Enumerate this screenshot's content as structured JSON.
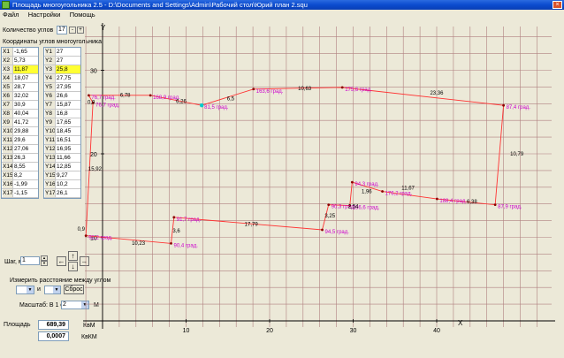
{
  "window": {
    "title": "Площадь многоугольника 2.5 - D:\\Documents and Settings\\Admin\\Рабочий стол\\Юрий план 2.squ",
    "close_glyph": "×"
  },
  "menu": [
    "Файл",
    "Настройки",
    "Помощь"
  ],
  "corners": {
    "label": "Количество углов",
    "value": "17",
    "minus": "-",
    "plus": "+"
  },
  "coords_heading": "Координаты углов многоугольника",
  "coords": {
    "x_labels": [
      "X1",
      "X2",
      "X3",
      "X4",
      "X5",
      "X6",
      "X7",
      "X8",
      "X9",
      "X10",
      "X11",
      "X12",
      "X13",
      "X14",
      "X15",
      "X16",
      "X17"
    ],
    "x_values": [
      "-1,65",
      "5,73",
      "11,87",
      "18,07",
      "28,7",
      "32,02",
      "30,9",
      "40,04",
      "41,72",
      "29,88",
      "29,6",
      "27,06",
      "26,3",
      "8,55",
      "8,2",
      "-1,99",
      "-1,15"
    ],
    "y_labels": [
      "Y1",
      "Y2",
      "Y3",
      "Y4",
      "Y5",
      "Y6",
      "Y7",
      "Y8",
      "Y9",
      "Y10",
      "Y11",
      "Y12",
      "Y13",
      "Y14",
      "Y15",
      "Y16",
      "Y17"
    ],
    "y_values": [
      "27",
      "27",
      "25,8",
      "27,75",
      "27,95",
      "26,6",
      "15,87",
      "16,8",
      "17,65",
      "18,45",
      "16,51",
      "16,95",
      "11,66",
      "12,85",
      "9,27",
      "10,2",
      "26,1"
    ],
    "highlight_row": 2
  },
  "step": {
    "label": "Шаг, м",
    "value": "1"
  },
  "arrows": {
    "left": "←",
    "up": "↑",
    "down": "↓",
    "right": "→"
  },
  "measure": {
    "label": "Измерить расстояние между углом",
    "and_label": "и",
    "reset_label": "Сброс"
  },
  "scale": {
    "label": "Масштаб:  В 1 см",
    "value": "2",
    "unit": "М"
  },
  "area": {
    "label": "Площадь",
    "value_m2": "689,39",
    "unit_m2": "КвМ",
    "value_km2": "0,0007",
    "unit_km2": "КвКМ"
  },
  "colors": {
    "polygon": "#ff3333",
    "angle_label": "#cc00cc",
    "side_label": "#000000",
    "grid": "#b08080",
    "vertex": "#8b0000",
    "selected_vertex": "#00cccc"
  },
  "chart_data": {
    "type": "scatter",
    "title": "",
    "xlabel": "X",
    "ylabel": "Y",
    "xlim": [
      -2,
      44
    ],
    "ylim": [
      1,
      34
    ],
    "x_ticks": [
      10,
      20,
      30,
      40
    ],
    "x_tick_labels": [
      "10",
      "20",
      "30",
      "40"
    ],
    "y_ticks": [
      10,
      20,
      30
    ],
    "y_tick_labels": [
      "10",
      "20",
      "30"
    ],
    "grid": true,
    "polygon_closed": true,
    "points": [
      {
        "x": -1.65,
        "y": 27
      },
      {
        "x": 5.73,
        "y": 27
      },
      {
        "x": 11.87,
        "y": 25.8
      },
      {
        "x": 18.07,
        "y": 27.75
      },
      {
        "x": 28.7,
        "y": 27.95
      },
      {
        "x": 48.0,
        "y": 25.8
      },
      {
        "x": 47.0,
        "y": 13.9
      },
      {
        "x": 40.04,
        "y": 14.6
      },
      {
        "x": 33.5,
        "y": 15.5
      },
      {
        "x": 29.88,
        "y": 16.6
      },
      {
        "x": 29.6,
        "y": 13.8
      },
      {
        "x": 27.06,
        "y": 13.9
      },
      {
        "x": 26.3,
        "y": 10.9
      },
      {
        "x": 8.55,
        "y": 12.4
      },
      {
        "x": 8.2,
        "y": 9.27
      },
      {
        "x": -1.99,
        "y": 10.2
      },
      {
        "x": -1.15,
        "y": 26.1
      }
    ],
    "angle_labels": [
      {
        "x": -1.65,
        "y": 27,
        "text": "76,7 град."
      },
      {
        "x": -1.15,
        "y": 26.1,
        "text": "76,7 град."
      },
      {
        "x": 5.73,
        "y": 27,
        "text": "168,9 град."
      },
      {
        "x": 11.87,
        "y": 25.8,
        "text": "81,5 град."
      },
      {
        "x": 18.07,
        "y": 27.75,
        "text": "163,6 град."
      },
      {
        "x": 28.7,
        "y": 27.95,
        "text": "175,6 град."
      },
      {
        "x": 48.0,
        "y": 25.8,
        "text": "87,4 град."
      },
      {
        "x": 47.0,
        "y": 13.9,
        "text": "87,9 град."
      },
      {
        "x": 40.04,
        "y": 14.6,
        "text": "188,4 град."
      },
      {
        "x": 33.5,
        "y": 15.5,
        "text": "176,2 град."
      },
      {
        "x": 29.88,
        "y": 16.6,
        "text": "94,3 град."
      },
      {
        "x": 29.6,
        "y": 13.8,
        "text": "266,6 град."
      },
      {
        "x": 27.06,
        "y": 13.9,
        "text": "90,3 град."
      },
      {
        "x": 26.3,
        "y": 10.9,
        "text": "94,5 град."
      },
      {
        "x": 8.55,
        "y": 12.4,
        "text": "91,7 град."
      },
      {
        "x": 8.2,
        "y": 9.27,
        "text": "90,4 град."
      },
      {
        "x": -1.99,
        "y": 10.2,
        "text": "92,2 град."
      }
    ],
    "side_labels": [
      {
        "x": 2.1,
        "y": 26.8,
        "text": "6,78"
      },
      {
        "x": 8.8,
        "y": 26.1,
        "text": "6,26"
      },
      {
        "x": 14.9,
        "y": 26.4,
        "text": "6,5"
      },
      {
        "x": 23.4,
        "y": 27.6,
        "text": "10,63"
      },
      {
        "x": 39.2,
        "y": 27.1,
        "text": "23,36"
      },
      {
        "x": 48.8,
        "y": 19.8,
        "text": "10,79"
      },
      {
        "x": 43.6,
        "y": 14.1,
        "text": "6,38"
      },
      {
        "x": 35.8,
        "y": 15.7,
        "text": "11,67"
      },
      {
        "x": 31.0,
        "y": 15.3,
        "text": "1,96"
      },
      {
        "x": 29.4,
        "y": 13.5,
        "text": "2,54"
      },
      {
        "x": 26.6,
        "y": 12.4,
        "text": "3,25"
      },
      {
        "x": 17.0,
        "y": 11.4,
        "text": "17,79"
      },
      {
        "x": 8.4,
        "y": 10.6,
        "text": "3,6"
      },
      {
        "x": 3.5,
        "y": 9.1,
        "text": "10,23"
      },
      {
        "x": -1.7,
        "y": 18.0,
        "text": "15,92"
      },
      {
        "x": -1.8,
        "y": 26.0,
        "text": "0,9"
      },
      {
        "x": -3.0,
        "y": 10.8,
        "text": "0,9"
      }
    ],
    "selected_point": 2
  }
}
